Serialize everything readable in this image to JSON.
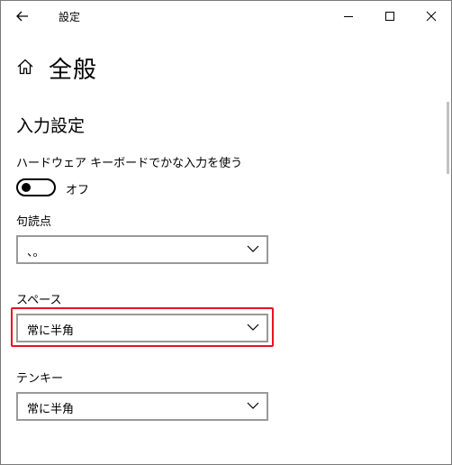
{
  "window": {
    "title": "設定"
  },
  "page": {
    "title": "全般"
  },
  "section": {
    "title": "入力設定"
  },
  "hardware_keyboard": {
    "label": "ハードウェア キーボードでかな入力を使う",
    "state": "オフ"
  },
  "punctuation": {
    "label": "句読点",
    "value": "、。"
  },
  "space": {
    "label": "スペース",
    "value": "常に半角"
  },
  "tenkey": {
    "label": "テンキー",
    "value": "常に半角"
  },
  "colors": {
    "highlight": "#e81123",
    "dropdown_border": "#999999"
  },
  "icons": {
    "back": "arrow-left-icon",
    "home": "home-icon",
    "minimize": "minimize-icon",
    "maximize": "maximize-icon",
    "close": "close-icon",
    "chevron": "chevron-down-icon"
  }
}
